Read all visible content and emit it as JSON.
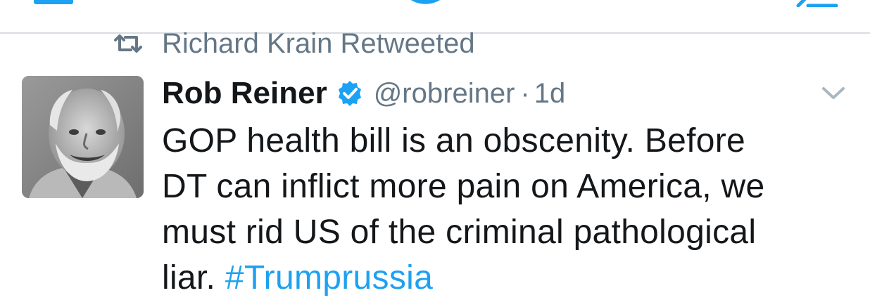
{
  "retweet": {
    "context": "Richard Krain Retweeted",
    "icon": "retweet-icon"
  },
  "tweet": {
    "display_name": "Rob Reiner",
    "verified": true,
    "handle": "@robreiner",
    "separator": "·",
    "time": "1d",
    "text_lines": [
      "GOP health bill is an obscenity. Before",
      "DT can inflict more pain on America, we",
      "must rid US of the criminal pathological"
    ],
    "last_line_text": "liar. ",
    "hashtag": "#Trumprussia",
    "menu_icon": "chevron-down-icon",
    "avatar_icon": "avatar"
  },
  "colors": {
    "brand_blue": "#1da1f2",
    "text_primary": "#14171a",
    "text_secondary": "#657786",
    "divider": "#d8dde2"
  }
}
